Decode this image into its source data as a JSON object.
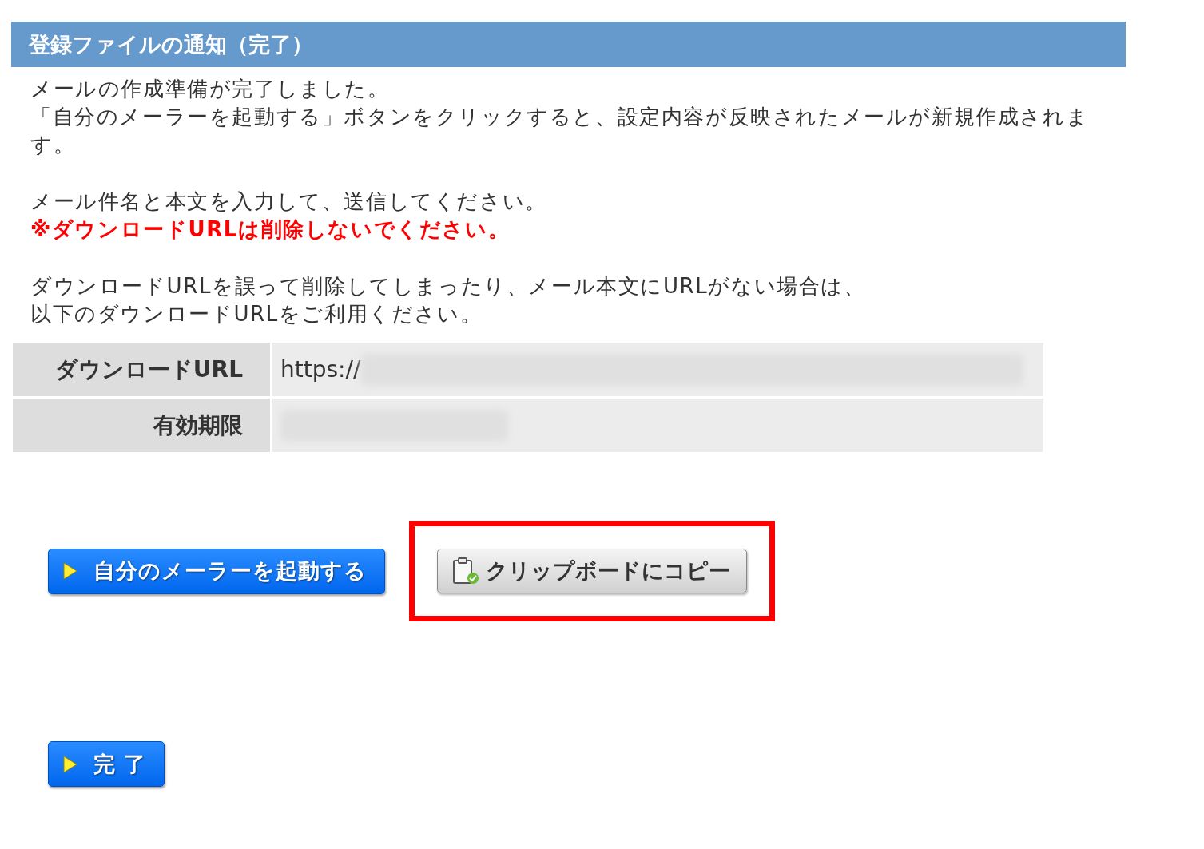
{
  "header": {
    "title": "登録ファイルの通知（完了）"
  },
  "paragraphs": [
    {
      "lines": [
        {
          "text": "メールの作成準備が完了しました。",
          "kind": "normal"
        },
        {
          "text": "「自分のメーラーを起動する」ボタンをクリックすると、設定内容が反映されたメールが新規作成されます。",
          "kind": "normal"
        }
      ]
    },
    {
      "lines": [
        {
          "text": "メール件名と本文を入力して、送信してください。",
          "kind": "normal"
        },
        {
          "text": "※ダウンロードURLは削除しないでください。",
          "kind": "warning"
        }
      ]
    },
    {
      "lines": [
        {
          "text": "ダウンロードURLを誤って削除してしまったり、メール本文にURLがない場合は、",
          "kind": "normal"
        },
        {
          "text": "以下のダウンロードURLをご利用ください。",
          "kind": "normal"
        }
      ]
    }
  ],
  "table": {
    "rows": [
      {
        "label": "ダウンロードURL",
        "value": "https://",
        "redacted": true
      },
      {
        "label": "有効期限",
        "redacted": true
      }
    ]
  },
  "buttons": [
    {
      "label": "自分のメーラーを起動する",
      "kind": "primary",
      "highlighted": false
    },
    {
      "label": "クリップボードにコピー",
      "kind": "copy",
      "highlighted": true
    }
  ],
  "finish_button": {
    "label": "完 了",
    "kind": "primary",
    "highlighted": false
  }
}
